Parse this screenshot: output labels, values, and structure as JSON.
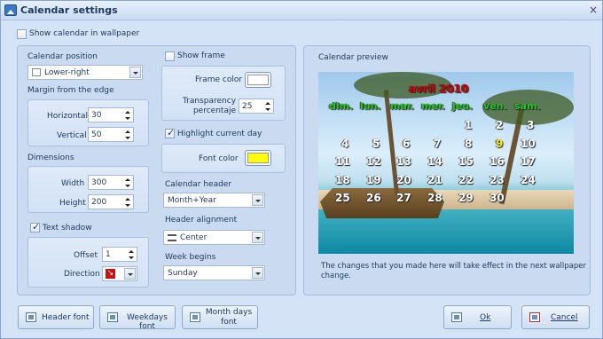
{
  "window": {
    "title": "Calendar settings",
    "close": "×"
  },
  "show_in_wallpaper": {
    "label": "Show calendar in wallpaper",
    "checked": false
  },
  "position": {
    "label": "Calendar position",
    "value": "Lower-right"
  },
  "margin": {
    "label": "Margin from the edge",
    "horizontal_label": "Horizontal",
    "horizontal": "30",
    "vertical_label": "Vertical",
    "vertical": "50"
  },
  "dimensions": {
    "label": "Dimensions",
    "width_label": "Width",
    "width": "300",
    "height_label": "Height",
    "height": "200"
  },
  "text_shadow": {
    "label": "Text shadow",
    "checked": true,
    "offset_label": "Offset",
    "offset": "1",
    "direction_label": "Direction",
    "direction_color": "#cc1111"
  },
  "frame": {
    "label": "Show frame",
    "checked": false,
    "color_label": "Frame color",
    "color": "#ffffff",
    "transparency_label": "Transparency percentaje",
    "transparency": "25"
  },
  "highlight": {
    "label": "Highlight current day",
    "checked": true,
    "font_color_label": "Font color",
    "font_color": "#ffff00"
  },
  "header": {
    "label": "Calendar header",
    "value": "Month+Year",
    "align_label": "Header alignment",
    "align_value": "Center",
    "week_label": "Week begins",
    "week_value": "Sunday"
  },
  "preview": {
    "title": "Calendar preview",
    "month": "avril 2010",
    "weekdays": [
      "dim.",
      "lun.",
      "mar.",
      "mer.",
      "jeu.",
      "ven.",
      "sam."
    ],
    "weeks": [
      [
        "",
        "",
        "",
        "",
        "1",
        "2",
        "3"
      ],
      [
        "4",
        "5",
        "6",
        "7",
        "8",
        "9",
        "10"
      ],
      [
        "11",
        "12",
        "13",
        "14",
        "15",
        "16",
        "17"
      ],
      [
        "18",
        "19",
        "20",
        "21",
        "22",
        "23",
        "24"
      ],
      [
        "25",
        "26",
        "27",
        "28",
        "29",
        "30",
        ""
      ]
    ],
    "today": "9",
    "colors": {
      "month": "#d40000",
      "weekdays": "#22cc22",
      "days": "#ffffff",
      "today": "#ffee00"
    },
    "note": "The changes that you made here will take effect in the next wallpaper change."
  },
  "buttons": {
    "header_font": "Header font",
    "weekdays_font": "Weekdays font",
    "month_days_font": "Month days font",
    "ok": "Ok",
    "cancel": "Cancel"
  }
}
